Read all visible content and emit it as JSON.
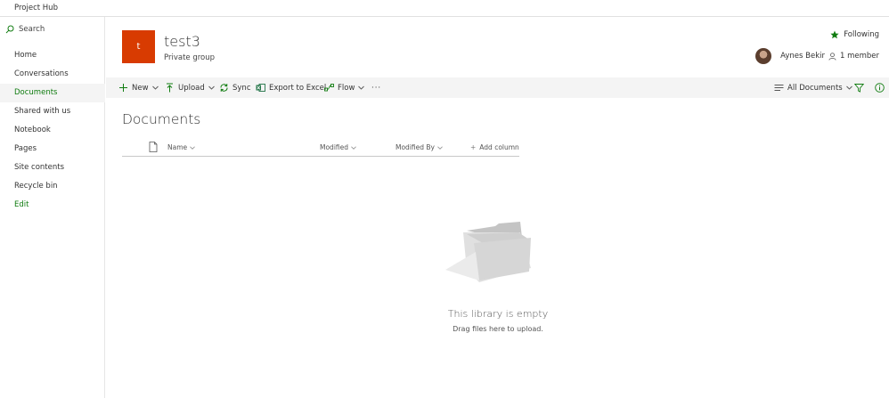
{
  "topbar": {
    "site_title": "Project Hub"
  },
  "leftnav": {
    "search_label": "Search",
    "items": [
      {
        "label": "Home",
        "selected": false
      },
      {
        "label": "Conversations",
        "selected": false
      },
      {
        "label": "Documents",
        "selected": true
      },
      {
        "label": "Shared with us",
        "selected": false
      },
      {
        "label": "Notebook",
        "selected": false
      },
      {
        "label": "Pages",
        "selected": false
      },
      {
        "label": "Site contents",
        "selected": false
      },
      {
        "label": "Recycle bin",
        "selected": false
      }
    ],
    "edit_label": "Edit"
  },
  "header": {
    "logo_letter": "t",
    "group_name": "test3",
    "group_type": "Private group",
    "following_label": "Following",
    "owner_name": "Aynes Bekir",
    "members_label": "1 member"
  },
  "commandbar": {
    "new_label": "New",
    "upload_label": "Upload",
    "sync_label": "Sync",
    "export_label": "Export to Excel",
    "flow_label": "Flow",
    "more_label": "···",
    "view_label": "All Documents"
  },
  "main": {
    "title": "Documents",
    "columns": {
      "name": "Name",
      "modified": "Modified",
      "modified_by": "Modified By",
      "add_column": "Add column"
    },
    "empty_title": "This library is empty",
    "empty_subtitle": "Drag files here to upload."
  },
  "colors": {
    "accent": "#107c10",
    "logo_bg": "#d83b01",
    "excel": "#217346",
    "info": "#107c10"
  }
}
